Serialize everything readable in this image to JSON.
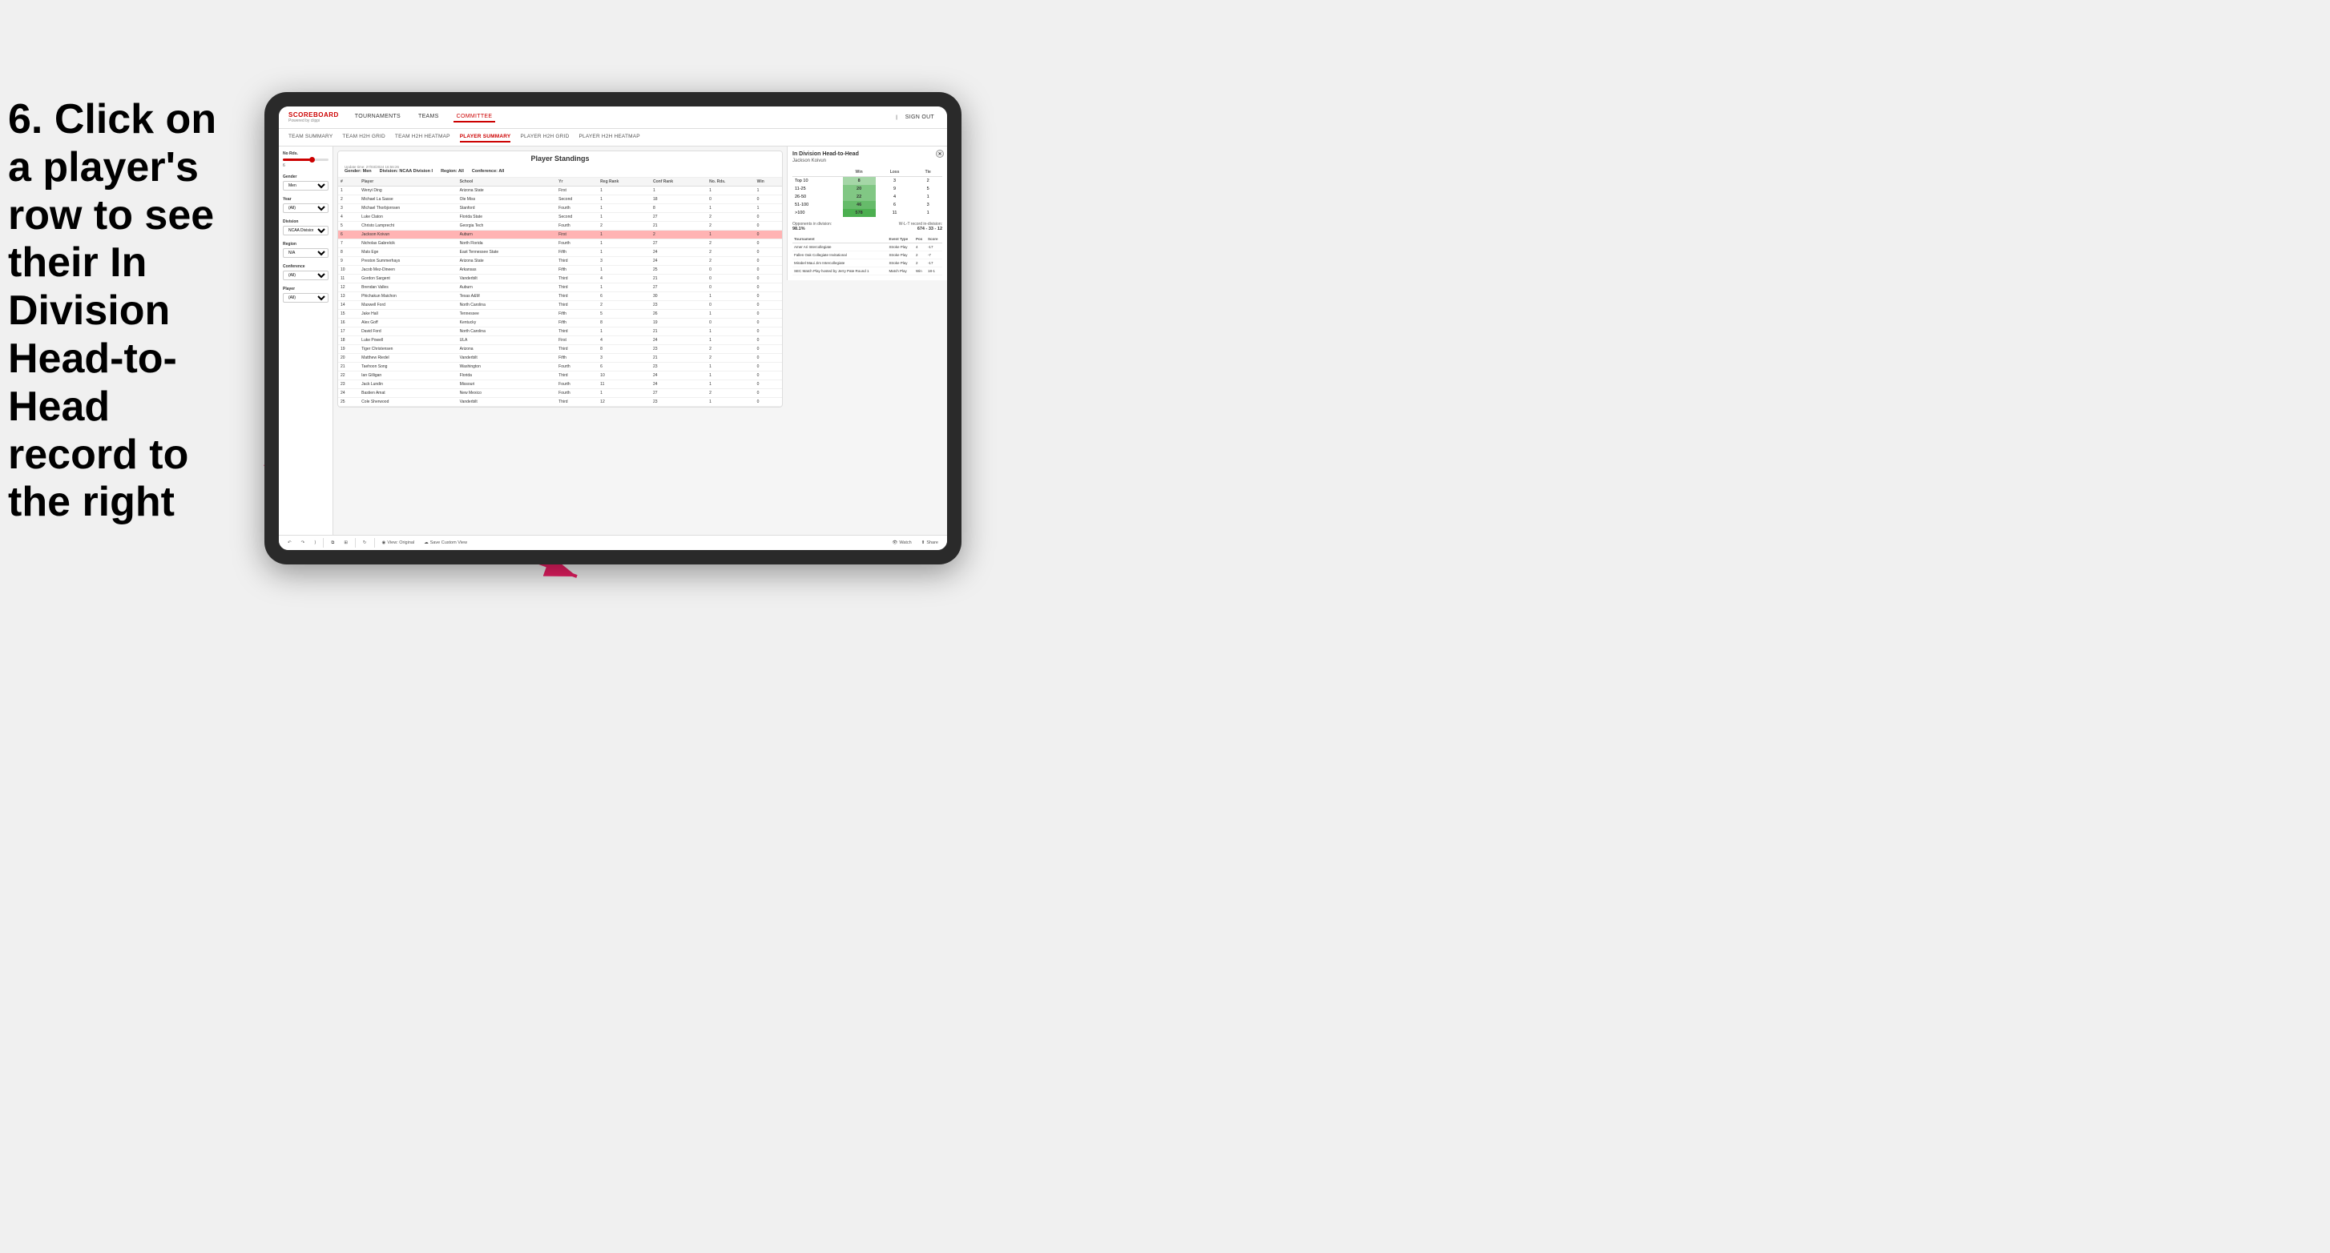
{
  "instruction": {
    "text": "6. Click on a player's row to see their In Division Head-to-Head record to the right"
  },
  "nav": {
    "logo": "SCOREBOARD",
    "logo_sub": "Powered by clippi",
    "items": [
      "TOURNAMENTS",
      "TEAMS",
      "COMMITTEE"
    ],
    "sign_out": "Sign out"
  },
  "sub_nav": {
    "items": [
      "TEAM SUMMARY",
      "TEAM H2H GRID",
      "TEAM H2H HEATMAP",
      "PLAYER SUMMARY",
      "PLAYER H2H GRID",
      "PLAYER H2H HEATMAP"
    ],
    "active": "PLAYER SUMMARY"
  },
  "filters": {
    "no_rds_label": "No Rds.",
    "no_rds_range": "6",
    "gender_label": "Gender",
    "gender_value": "Men",
    "year_label": "Year",
    "year_value": "(All)",
    "division_label": "Division",
    "division_value": "NCAA Division I",
    "region_label": "Region",
    "region_value": "N/A",
    "conference_label": "Conference",
    "conference_value": "(All)",
    "player_label": "Player",
    "player_value": "(All)"
  },
  "standings": {
    "title": "Player Standings",
    "update_time": "Update time: 27/03/2024 16:56:26",
    "gender": "Men",
    "division": "NCAA Division I",
    "region": "All",
    "conference": "All",
    "columns": [
      "#",
      "Player",
      "School",
      "Yr",
      "Reg Rank",
      "Conf Rank",
      "No. Rds.",
      "Win"
    ],
    "rows": [
      {
        "num": "1",
        "name": "Wenyi Ding",
        "school": "Arizona State",
        "yr": "First",
        "reg": "1",
        "conf": "1",
        "rds": "1",
        "win": "1"
      },
      {
        "num": "2",
        "name": "Michael La Sasse",
        "school": "Ole Miss",
        "yr": "Second",
        "reg": "1",
        "conf": "18",
        "rds": "0",
        "win": "0"
      },
      {
        "num": "3",
        "name": "Michael Thorbjornsen",
        "school": "Stanford",
        "yr": "Fourth",
        "reg": "1",
        "conf": "8",
        "rds": "1",
        "win": "1"
      },
      {
        "num": "4",
        "name": "Luke Claton",
        "school": "Florida State",
        "yr": "Second",
        "reg": "1",
        "conf": "27",
        "rds": "2",
        "win": "0"
      },
      {
        "num": "5",
        "name": "Christo Lamprecht",
        "school": "Georgia Tech",
        "yr": "Fourth",
        "reg": "2",
        "conf": "21",
        "rds": "2",
        "win": "0"
      },
      {
        "num": "6",
        "name": "Jackson Koivun",
        "school": "Auburn",
        "yr": "First",
        "reg": "1",
        "conf": "2",
        "rds": "1",
        "win": "0",
        "selected": true
      },
      {
        "num": "7",
        "name": "Nicholas Gabrelcik",
        "school": "North Florida",
        "yr": "Fourth",
        "reg": "1",
        "conf": "27",
        "rds": "2",
        "win": "0"
      },
      {
        "num": "8",
        "name": "Mats Ege",
        "school": "East Tennessee State",
        "yr": "Fifth",
        "reg": "1",
        "conf": "24",
        "rds": "2",
        "win": "0"
      },
      {
        "num": "9",
        "name": "Preston Summerhays",
        "school": "Arizona State",
        "yr": "Third",
        "reg": "3",
        "conf": "24",
        "rds": "2",
        "win": "0"
      },
      {
        "num": "10",
        "name": "Jacob Mez-Dineen",
        "school": "Arkansas",
        "yr": "Fifth",
        "reg": "1",
        "conf": "25",
        "rds": "0",
        "win": "0"
      },
      {
        "num": "11",
        "name": "Gordon Sargent",
        "school": "Vanderbilt",
        "yr": "Third",
        "reg": "4",
        "conf": "21",
        "rds": "0",
        "win": "0"
      },
      {
        "num": "12",
        "name": "Brendan Valles",
        "school": "Auburn",
        "yr": "Third",
        "reg": "1",
        "conf": "27",
        "rds": "0",
        "win": "0"
      },
      {
        "num": "13",
        "name": "Phichakun Maichon",
        "school": "Texas A&M",
        "yr": "Third",
        "reg": "6",
        "conf": "30",
        "rds": "1",
        "win": "0"
      },
      {
        "num": "14",
        "name": "Maxwell Ford",
        "school": "North Carolina",
        "yr": "Third",
        "reg": "2",
        "conf": "23",
        "rds": "0",
        "win": "0"
      },
      {
        "num": "15",
        "name": "Jake Hall",
        "school": "Tennessee",
        "yr": "Fifth",
        "reg": "5",
        "conf": "26",
        "rds": "1",
        "win": "0"
      },
      {
        "num": "16",
        "name": "Alex Goff",
        "school": "Kentucky",
        "yr": "Fifth",
        "reg": "8",
        "conf": "19",
        "rds": "0",
        "win": "0"
      },
      {
        "num": "17",
        "name": "David Ford",
        "school": "North Carolina",
        "yr": "Third",
        "reg": "1",
        "conf": "21",
        "rds": "1",
        "win": "0"
      },
      {
        "num": "18",
        "name": "Luke Powell",
        "school": "ULA",
        "yr": "First",
        "reg": "4",
        "conf": "24",
        "rds": "1",
        "win": "0"
      },
      {
        "num": "19",
        "name": "Tiger Christensen",
        "school": "Arizona",
        "yr": "Third",
        "reg": "8",
        "conf": "23",
        "rds": "2",
        "win": "0"
      },
      {
        "num": "20",
        "name": "Matthew Riedel",
        "school": "Vanderbilt",
        "yr": "Fifth",
        "reg": "3",
        "conf": "21",
        "rds": "2",
        "win": "0"
      },
      {
        "num": "21",
        "name": "Taehoon Song",
        "school": "Washington",
        "yr": "Fourth",
        "reg": "6",
        "conf": "23",
        "rds": "1",
        "win": "0"
      },
      {
        "num": "22",
        "name": "Ian Gilligan",
        "school": "Florida",
        "yr": "Third",
        "reg": "10",
        "conf": "24",
        "rds": "1",
        "win": "0"
      },
      {
        "num": "23",
        "name": "Jack Lundin",
        "school": "Missouri",
        "yr": "Fourth",
        "reg": "11",
        "conf": "24",
        "rds": "1",
        "win": "0"
      },
      {
        "num": "24",
        "name": "Bastien Amat",
        "school": "New Mexico",
        "yr": "Fourth",
        "reg": "1",
        "conf": "27",
        "rds": "2",
        "win": "0"
      },
      {
        "num": "25",
        "name": "Cole Sherwood",
        "school": "Vanderbilt",
        "yr": "Third",
        "reg": "12",
        "conf": "23",
        "rds": "1",
        "win": "0"
      }
    ]
  },
  "h2h": {
    "title": "In Division Head-to-Head",
    "player_name": "Jackson Koivun",
    "table_headers": [
      "",
      "Win",
      "Loss",
      "Tie"
    ],
    "rows": [
      {
        "rank": "Top 10",
        "win": "8",
        "loss": "3",
        "tie": "2"
      },
      {
        "rank": "11-25",
        "win": "20",
        "loss": "9",
        "tie": "5"
      },
      {
        "rank": "26-50",
        "win": "22",
        "loss": "4",
        "tie": "1"
      },
      {
        "rank": "51-100",
        "win": "46",
        "loss": "6",
        "tie": "3"
      },
      {
        "rank": ">100",
        "win": "578",
        "loss": "11",
        "tie": "1"
      }
    ],
    "opponents_label": "Opponents in division:",
    "record_label": "W-L-T record in-division:",
    "opponents_pct": "98.1%",
    "record": "674 - 33 - 12",
    "tournaments_headers": [
      "Tournament",
      "Event Type",
      "Pos",
      "Score"
    ],
    "tournaments": [
      {
        "name": "Amer Ari Intercollegiate",
        "type": "Stroke Play",
        "pos": "4",
        "score": "-17"
      },
      {
        "name": "Fallen Oak Collegiate Invitational",
        "type": "Stroke Play",
        "pos": "2",
        "score": "-7"
      },
      {
        "name": "Mirabel Maui Jim Intercollegiate",
        "type": "Stroke Play",
        "pos": "2",
        "score": "-17"
      },
      {
        "name": "SEC Match Play hosted by Jerry Pate Round 1",
        "type": "Match Play",
        "pos": "Win",
        "score": "18-1"
      }
    ]
  },
  "toolbar": {
    "view_original": "View: Original",
    "save_custom": "Save Custom View",
    "watch": "Watch",
    "share": "Share"
  }
}
